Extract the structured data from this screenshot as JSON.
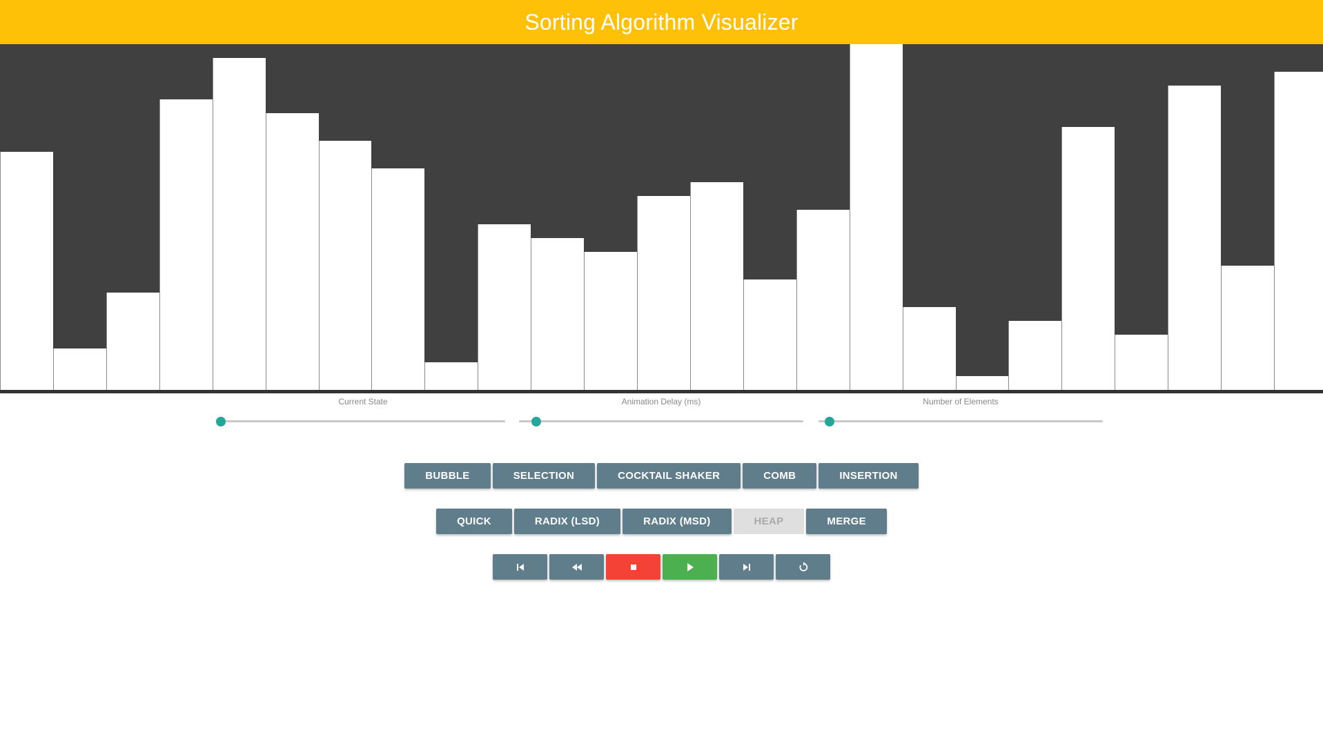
{
  "app": {
    "title": "Sorting Algorithm Visualizer"
  },
  "bars": {
    "max_value": 100,
    "values": [
      68.9,
      11.9,
      28.1,
      84.0,
      96.1,
      80.0,
      72.0,
      64.0,
      8.0,
      48.0,
      44.0,
      40.0,
      56.0,
      60.0,
      32.0,
      52.0,
      100.0,
      24.0,
      4.0,
      20.0,
      76.0,
      16.0,
      88.0,
      36.0,
      92.0
    ],
    "fill_color": "#ffffff",
    "background_color": "#404040"
  },
  "sliders": [
    {
      "label": "Current State",
      "value_fraction": 0.0
    },
    {
      "label": "Animation Delay (ms)",
      "value_fraction": 0.06
    },
    {
      "label": "Number of Elements",
      "value_fraction": 0.04
    }
  ],
  "algorithms": {
    "row1": [
      {
        "label": "BUBBLE",
        "enabled": true
      },
      {
        "label": "SELECTION",
        "enabled": true
      },
      {
        "label": "COCKTAIL SHAKER",
        "enabled": true
      },
      {
        "label": "COMB",
        "enabled": true
      },
      {
        "label": "INSERTION",
        "enabled": true
      }
    ],
    "row2": [
      {
        "label": "QUICK",
        "enabled": true
      },
      {
        "label": "RADIX (LSD)",
        "enabled": true
      },
      {
        "label": "RADIX (MSD)",
        "enabled": true
      },
      {
        "label": "HEAP",
        "enabled": false
      },
      {
        "label": "MERGE",
        "enabled": true
      }
    ]
  },
  "playback": {
    "buttons": [
      {
        "icon": "skip-previous-icon"
      },
      {
        "icon": "rewind-icon"
      },
      {
        "icon": "stop-icon"
      },
      {
        "icon": "play-icon"
      },
      {
        "icon": "skip-next-icon"
      },
      {
        "icon": "replay-icon"
      }
    ]
  },
  "colors": {
    "app_bar": "#ffc107",
    "button": "#607d8b",
    "button_disabled": "#dfdfdf",
    "stop": "#f44336",
    "play": "#4caf50",
    "slider_thumb": "#26a69a"
  }
}
